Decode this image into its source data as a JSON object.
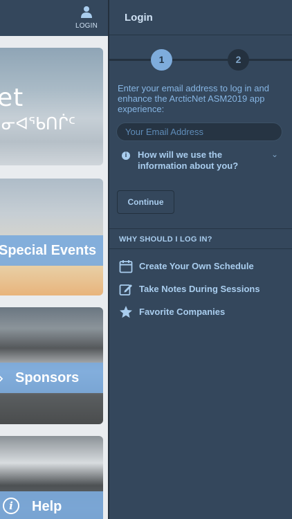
{
  "header": {
    "login_label": "LOGIN"
  },
  "tiles": {
    "hero": {
      "logo_line1": "et",
      "logo_line2": "ᓂᐊᖃᑎᒌᑦ"
    },
    "events": "Special Events",
    "sponsors": "Sponsors",
    "help": "Help"
  },
  "panel": {
    "title": "Login",
    "steps": [
      "1",
      "2"
    ],
    "intro": "Enter your email address to log in and enhance the ArcticNet ASM2019 app experience:",
    "email_placeholder": "Your Email Address",
    "how_use": "How will we use the information about you?",
    "continue_label": "Continue",
    "why_heading": "WHY SHOULD I LOG IN?",
    "features": [
      {
        "label": "Create Your Own Schedule",
        "icon": "calendar-icon"
      },
      {
        "label": "Take Notes During Sessions",
        "icon": "edit-icon"
      },
      {
        "label": "Favorite Companies",
        "icon": "star-icon"
      }
    ]
  },
  "colors": {
    "panel_bg": "#34475c",
    "accent": "#7eacdc",
    "text": "#a9cdee"
  }
}
